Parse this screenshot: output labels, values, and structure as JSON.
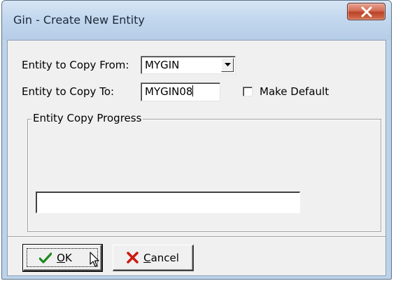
{
  "window": {
    "title": "Gin - Create New Entity"
  },
  "form": {
    "copy_from_label": "Entity to Copy From:",
    "copy_from_value": "MYGIN",
    "copy_to_label": "Entity to Copy To:",
    "copy_to_value": "MYGIN08",
    "make_default_label": "Make Default",
    "make_default_checked": false
  },
  "progress_group": {
    "title": "Entity Copy Progress",
    "progress_fraction": 0
  },
  "buttons": {
    "ok_label": "OK",
    "cancel_label": "Cancel"
  },
  "colors": {
    "ok_check": "#1c8a1c",
    "cancel_x": "#cc1a12",
    "close_button": "#c8553c"
  },
  "icons": {
    "close": "close-icon",
    "dropdown": "chevron-down-icon",
    "ok": "checkmark-icon",
    "cancel": "x-icon",
    "cursor": "mouse-cursor-icon"
  }
}
